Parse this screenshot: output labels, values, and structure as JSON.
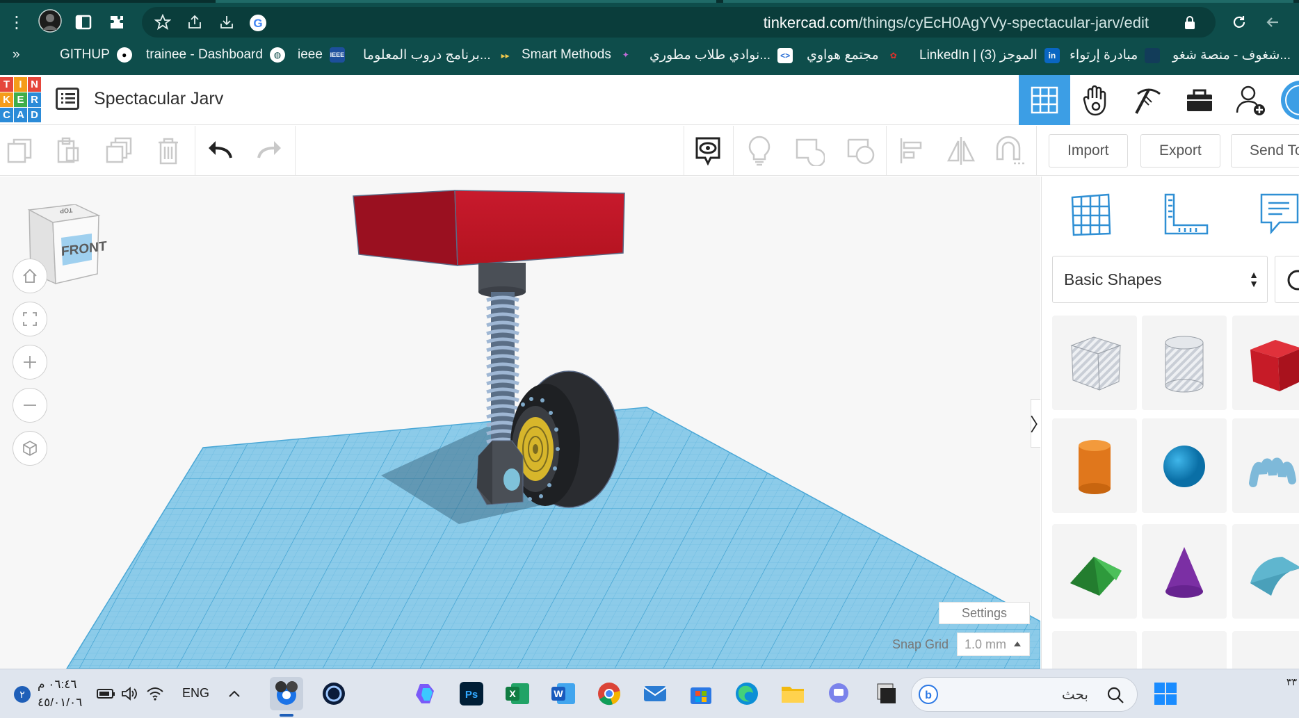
{
  "browser": {
    "url_host": "tinkercad.com",
    "url_path": "/things/cyEcH0AgYVy-spectacular-jarv/edit",
    "bookmarks": [
      {
        "label": "GITHUP",
        "icon": "github-icon"
      },
      {
        "label": "trainee - Dashboard",
        "icon": "globe-icon"
      },
      {
        "label": "ieee",
        "icon": "ieee-icon"
      },
      {
        "label": "برنامج دروب المعلوما...",
        "icon": "bookmark-icon"
      },
      {
        "label": "Smart Methods",
        "icon": "smart-methods-icon"
      },
      {
        "label": "نوادي طلاب مطوري...",
        "icon": "code-icon"
      },
      {
        "label": "مجتمع هواوي",
        "icon": "huawei-icon"
      },
      {
        "label": "LinkedIn | الموجز (3)",
        "icon": "linkedin-icon"
      },
      {
        "label": "مبادرة إرتواء",
        "icon": "bookmark-icon"
      },
      {
        "label": "شغوف - منصة شغو...",
        "icon": "bookmark-icon"
      }
    ],
    "more_bookmarks": "»"
  },
  "tinkercad": {
    "logo_letters": [
      "T",
      "I",
      "N",
      "K",
      "E",
      "R",
      "C",
      "A",
      "D"
    ],
    "design_title": "Spectacular Jarv",
    "toolbar": {
      "import_label": "Import",
      "export_label": "Export",
      "send_label": "Send To"
    },
    "view_cube": {
      "front_label": "FRONT",
      "top_label": "TOP"
    },
    "settings_label": "Settings",
    "snap_grid_label": "Snap Grid",
    "snap_grid_value": "1.0 mm",
    "panel": {
      "shape_category": "Basic Shapes"
    },
    "colors": {
      "accent": "#3c9ee5",
      "box_red": "#c0152a",
      "grid_blue": "#7cc4e6",
      "logo_red": "#e5463b",
      "logo_orange": "#f59c1a",
      "logo_green": "#3fae4a",
      "logo_blue": "#2b8bd8"
    }
  },
  "taskbar": {
    "time": "٠٦:٤٦ م",
    "date": "٤٥/٠١/٠٦",
    "language": "ENG",
    "search_placeholder": "بحث",
    "notification_count": "٢",
    "right_edge_text": "٣٣"
  }
}
